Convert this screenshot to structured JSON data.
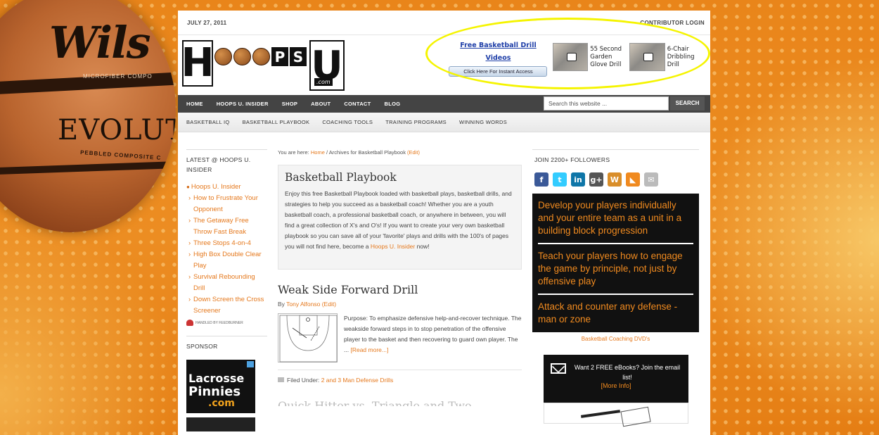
{
  "ball": {
    "brand": "Wils",
    "sub": "MICROFIBER  COMPO",
    "model": "EVOLUT",
    "pebbled": "PEBBLED COMPOSITE C"
  },
  "topbar": {
    "date": "JULY 27, 2011",
    "login": "CONTRIBUTOR LOGIN"
  },
  "logo": {
    "h": "H",
    "ps": [
      "P",
      "S"
    ],
    "u": "U",
    "com": ".com"
  },
  "ad": {
    "link": "Free Basketball Drill Videos",
    "button": "Click Here For Instant Access",
    "videos": [
      {
        "caption": "55 Second Garden Glove Drill"
      },
      {
        "caption": "6-Chair Dribbling Drill"
      }
    ]
  },
  "nav": {
    "primary": [
      "HOME",
      "HOOPS U. INSIDER",
      "SHOP",
      "ABOUT",
      "CONTACT",
      "BLOG"
    ],
    "search_placeholder": "Search this website ...",
    "search_button": "SEARCH",
    "secondary": [
      "BASKETBALL IQ",
      "BASKETBALL PLAYBOOK",
      "COACHING TOOLS",
      "TRAINING PROGRAMS",
      "WINNING WORDS"
    ]
  },
  "left": {
    "latest_title": "LATEST @ HOOPS U. INSIDER",
    "items": [
      "Hoops U. Insider",
      "How to Frustrate Your Opponent",
      "The Getaway Free Throw Fast Break",
      "Three Stops 4-on-4",
      "High Box Double Clear Play",
      "Survival Rebounding Drill",
      "Down Screen the Cross Screener"
    ],
    "hosted": "HANDLED BY FEEDBURNER",
    "sponsor_title": "SPONSOR",
    "lax": {
      "l1": "Lacrosse",
      "l2": "Pinnies",
      "l3": ".com"
    }
  },
  "main": {
    "crumb_prefix": "You are here:",
    "crumb_home": "Home",
    "crumb_rest": "/ Archives for Basketball Playbook",
    "crumb_edit": "(Edit)",
    "intro_title": "Basketball Playbook",
    "intro_text": "Enjoy this free Basketball Playbook loaded with basketball plays, basketball drills, and strategies to help you succeed as a basketball coach! Whether you are a youth basketball coach, a professional basketball coach, or anywhere in between, you will find a great collection of X's and O's! If you want to create your very own basketball playbook so you can save all of your 'favorite' plays and drills with the 100's of pages you will not find here, become a",
    "intro_link": "Hoops U. Insider",
    "intro_end": "now!",
    "post_title": "Weak Side Forward Drill",
    "post_by": "By",
    "post_author": "Tony Alfonso",
    "post_edit": "(Edit)",
    "post_excerpt": "Purpose: To emphasize defensive help-and-recover technique. The weakside forward steps in to stop penetration of the offensive player to the basket and then recovering to guard own player. The ...",
    "read_more": "[Read more...]",
    "filed_under": "Filed Under:",
    "filed_link": "2 and 3 Man Defense Drills",
    "next_title": "Quick Hitter vs. Triangle and Two"
  },
  "right": {
    "follow_title": "JOIN 2200+ FOLLOWERS",
    "social": [
      {
        "name": "facebook-icon",
        "glyph": "f",
        "color": "#3b5998"
      },
      {
        "name": "twitter-icon",
        "glyph": "t",
        "color": "#33ccff"
      },
      {
        "name": "linkedin-icon",
        "glyph": "in",
        "color": "#0e76a8"
      },
      {
        "name": "googleplus-icon",
        "glyph": "g+",
        "color": "#555555"
      },
      {
        "name": "wordpress-icon",
        "glyph": "W",
        "color": "#d98e2a"
      },
      {
        "name": "rss-icon",
        "glyph": "◣",
        "color": "#f08a1f"
      },
      {
        "name": "email-icon",
        "glyph": "✉",
        "color": "#bbbbbb"
      }
    ],
    "promo": [
      "Develop your players individually and your entire team as a unit in a building block progression",
      "Teach your players how to engage the game by principle, not just by offensive play",
      "Attack and counter any defense - man or zone"
    ],
    "promo_caption": "Basketball Coaching DVD's",
    "ebook_text": "Want 2 FREE eBooks? Join the email list!",
    "ebook_more": "[More Info]"
  },
  "colors": {
    "accent": "#e5781c",
    "highlight": "#f5f400",
    "nav": "#444444"
  }
}
